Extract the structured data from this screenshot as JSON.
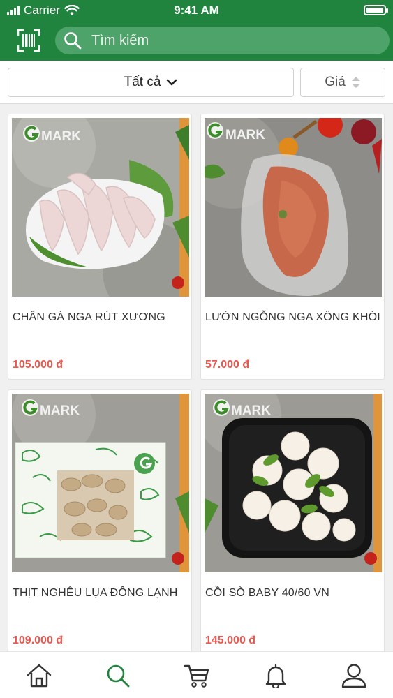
{
  "status_bar": {
    "carrier": "Carrier",
    "time": "9:41 AM",
    "battery_level": 1.0
  },
  "header": {
    "scan_icon": "barcode-scan-icon",
    "search": {
      "icon": "search-icon",
      "placeholder": "Tìm kiếm"
    }
  },
  "filters": {
    "category": {
      "label": "Tất cả",
      "icon": "chevron-down-icon"
    },
    "sort": {
      "label": "Giá",
      "icon": "sort-icon"
    }
  },
  "products": [
    {
      "name": "CHÂN GÀ NGA RÚT XƯƠNG",
      "price": "105.000 đ",
      "image": "chicken-feet-photo",
      "brand_text": "MARK"
    },
    {
      "name": "LƯỜN NGỖNG NGA XÔNG KHÓI",
      "price": "57.000 đ",
      "image": "smoked-goose-breast-photo",
      "brand_text": "MARK"
    },
    {
      "name": "THỊT NGHÊU LỤA ĐÔNG LẠNH",
      "price": "109.000 đ",
      "image": "frozen-clam-meat-photo",
      "brand_text": "MARK"
    },
    {
      "name": "CỒI SÒ BABY 40/60 VN",
      "price": "145.000 đ",
      "image": "baby-scallop-photo",
      "brand_text": "MARK"
    }
  ],
  "tabbar": {
    "items": [
      {
        "name": "home",
        "icon": "home-icon",
        "active": false
      },
      {
        "name": "search",
        "icon": "search-icon",
        "active": true
      },
      {
        "name": "cart",
        "icon": "cart-icon",
        "active": false
      },
      {
        "name": "notifications",
        "icon": "bell-icon",
        "active": false
      },
      {
        "name": "profile",
        "icon": "user-icon",
        "active": false
      }
    ]
  },
  "colors": {
    "brand_green": "#20843f",
    "search_bg": "#4ea36a",
    "price_red": "#e8584e",
    "active_tab": "#20843f",
    "inactive_tab": "#333333"
  }
}
